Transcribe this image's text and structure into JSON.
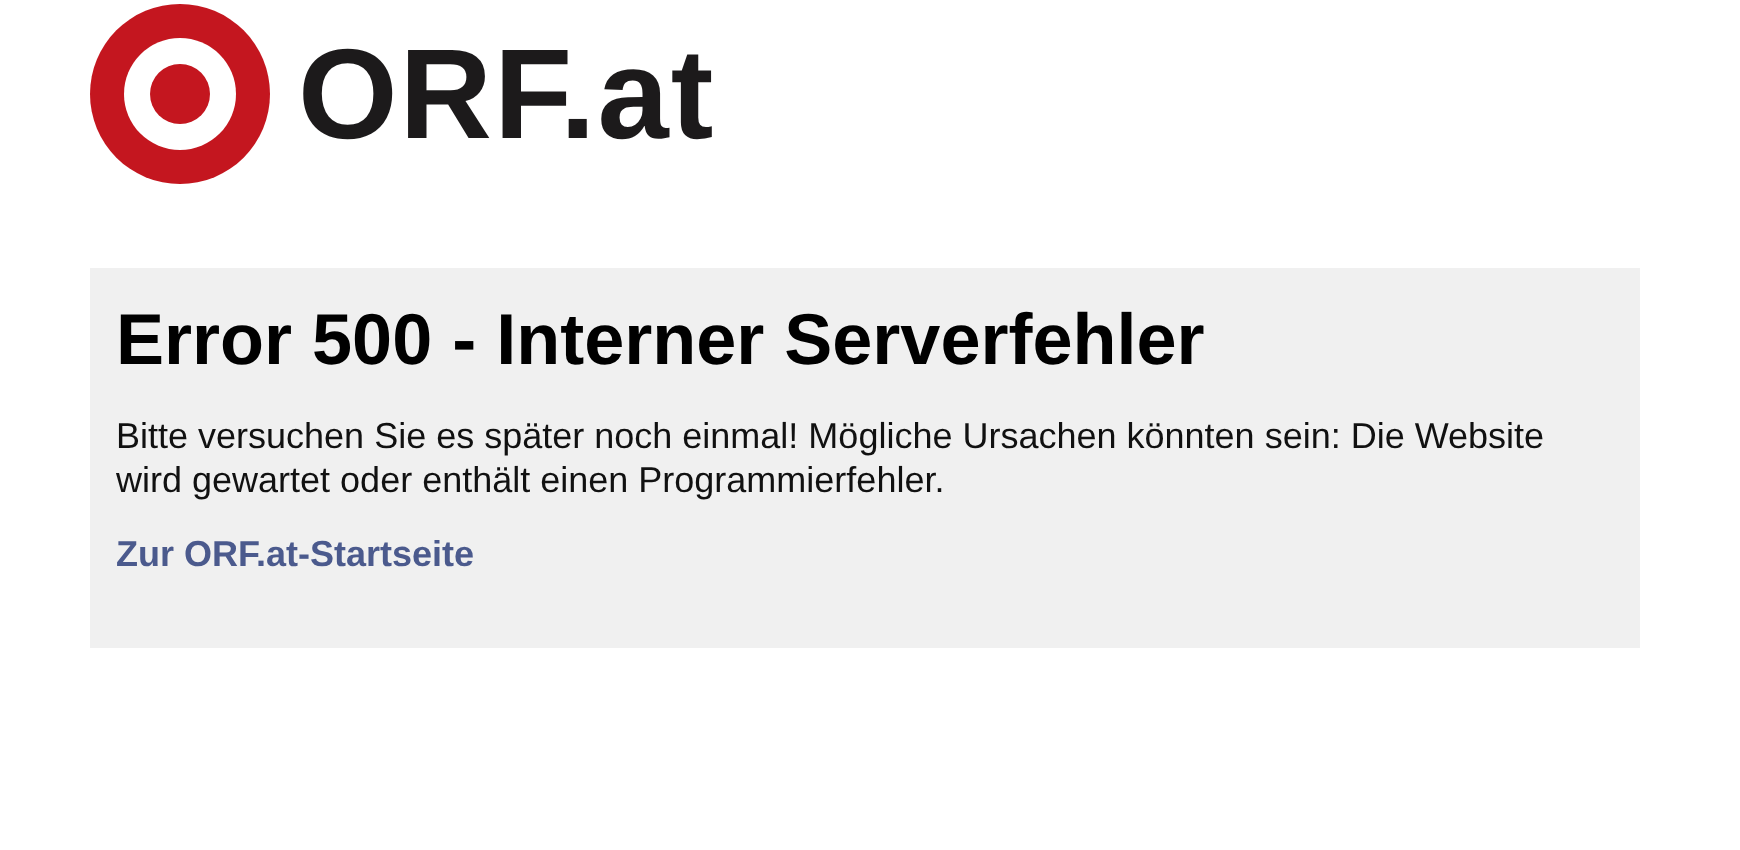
{
  "logo": {
    "text": "ORF.at"
  },
  "error": {
    "title": "Error 500 - Interner Serverfehler",
    "message": "Bitte versuchen Sie es später noch einmal! Mögliche Ursachen könnten sein: Die Website wird gewartet oder enthält einen Programmierfehler.",
    "link": "Zur ORF.at-Startseite"
  }
}
